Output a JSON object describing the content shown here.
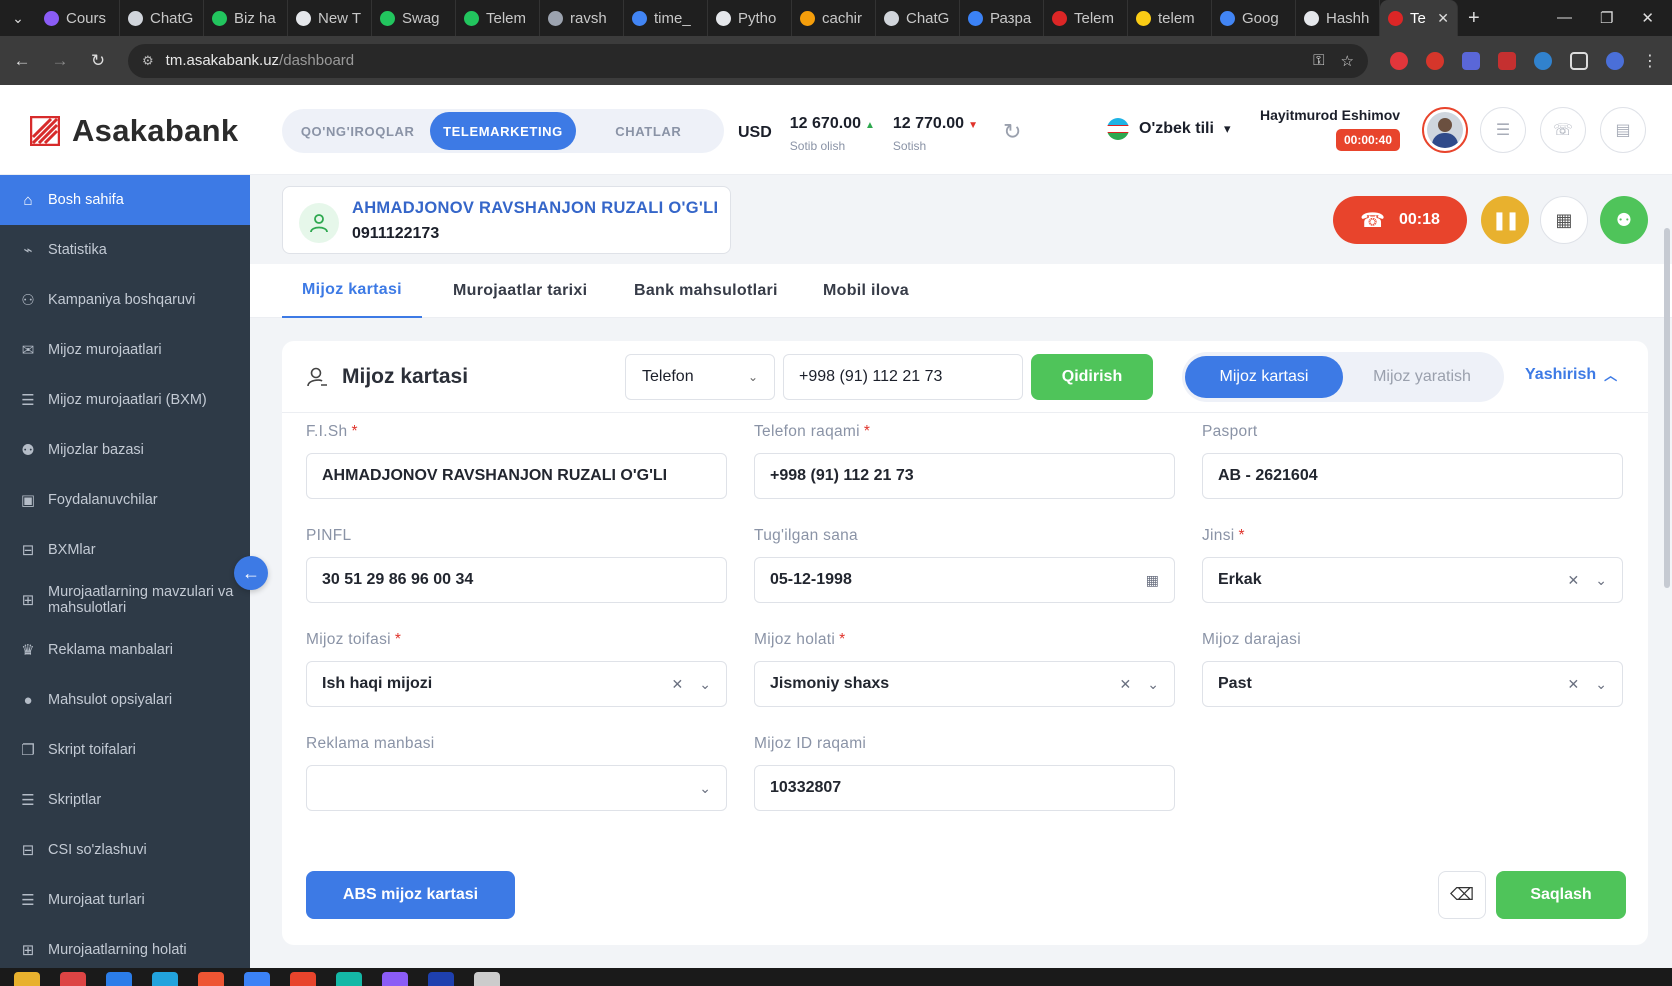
{
  "browser": {
    "tabs": [
      {
        "title": "Cours",
        "color": "#8b5cf6"
      },
      {
        "title": "ChatG",
        "color": "#d1d5db"
      },
      {
        "title": "Biz ha",
        "color": "#22c55e"
      },
      {
        "title": "New T",
        "color": "#e5e7eb"
      },
      {
        "title": "Swag",
        "color": "#22c55e"
      },
      {
        "title": "Telem",
        "color": "#22c55e"
      },
      {
        "title": "ravsh",
        "color": "#9ca3af"
      },
      {
        "title": "time_",
        "color": "#4285f4"
      },
      {
        "title": "Pytho",
        "color": "#e5e7eb"
      },
      {
        "title": "cachir",
        "color": "#f59e0b"
      },
      {
        "title": "ChatG",
        "color": "#d1d5db"
      },
      {
        "title": "Разра",
        "color": "#3b82f6"
      },
      {
        "title": "Telem",
        "color": "#dc2626"
      },
      {
        "title": "telem",
        "color": "#facc15"
      },
      {
        "title": "Goog",
        "color": "#4285f4"
      },
      {
        "title": "Hashh",
        "color": "#e5e7eb"
      },
      {
        "title": "Te",
        "color": "#dc2626"
      }
    ],
    "url_host": "tm.asakabank.uz",
    "url_path": "/dashboard"
  },
  "header": {
    "brand": "Asakabank",
    "modes": [
      "QO'NG'IROQLAR",
      "TELEMARKETING",
      "CHATLAR"
    ],
    "active_mode": "TELEMARKETING",
    "currency": {
      "code": "USD",
      "buy_value": "12 670.00",
      "buy_label": "Sotib olish",
      "sell_value": "12 770.00",
      "sell_label": "Sotish"
    },
    "language": "O'zbek tili",
    "user_name": "Hayitmurod Eshimov",
    "user_timer": "00:00:40"
  },
  "sidebar": {
    "items": [
      {
        "label": "Bosh sahifa",
        "icon": "home-icon",
        "glyph": "⌂"
      },
      {
        "label": "Statistika",
        "icon": "chart-icon",
        "glyph": "⌁"
      },
      {
        "label": "Kampaniya boshqaruvi",
        "icon": "users-group-icon",
        "glyph": "⚇"
      },
      {
        "label": "Mijoz murojaatlari",
        "icon": "chat-icon",
        "glyph": "✉"
      },
      {
        "label": "Mijoz murojaatlari (BXM)",
        "icon": "list-icon",
        "glyph": "☰"
      },
      {
        "label": "Mijozlar bazasi",
        "icon": "people-icon",
        "glyph": "⚉"
      },
      {
        "label": "Foydalanuvchilar",
        "icon": "user-card-icon",
        "glyph": "▣"
      },
      {
        "label": "BXMlar",
        "icon": "inbox-icon",
        "glyph": "⊟"
      },
      {
        "label": "Murojaatlarning mavzulari va mahsulotlari",
        "icon": "topics-icon",
        "glyph": "⊞"
      },
      {
        "label": "Reklama manbalari",
        "icon": "trophy-icon",
        "glyph": "♛"
      },
      {
        "label": "Mahsulot opsiyalari",
        "icon": "option-icon",
        "glyph": "●"
      },
      {
        "label": "Skript toifalari",
        "icon": "copy-icon",
        "glyph": "❐"
      },
      {
        "label": "Skriptlar",
        "icon": "script-icon",
        "glyph": "☰"
      },
      {
        "label": "CSI so'zlashuvi",
        "icon": "csi-icon",
        "glyph": "⊟"
      },
      {
        "label": "Murojaat turlari",
        "icon": "types-icon",
        "glyph": "☰"
      },
      {
        "label": "Murojaatlarning holati",
        "icon": "grid-icon",
        "glyph": "⊞"
      }
    ]
  },
  "caller": {
    "name": "AHMADJONOV RAVSHANJON RUZALI O'G'LI",
    "phone": "0911122173",
    "call_timer": "00:18"
  },
  "main_tabs": [
    "Mijoz kartasi",
    "Murojaatlar tarixi",
    "Bank mahsulotlari",
    "Mobil ilova"
  ],
  "card": {
    "title": "Mijoz kartasi",
    "search_type": "Telefon",
    "search_value": "+998 (91) 112 21 73",
    "search_button": "Qidirish",
    "segments": [
      "Mijoz kartasi",
      "Mijoz yaratish"
    ],
    "hide_label": "Yashirish",
    "fields": {
      "fish": {
        "label": "F.I.Sh",
        "value": "AHMADJONOV RAVSHANJON RUZALI O'G'LI"
      },
      "phone": {
        "label": "Telefon raqami",
        "value": "+998 (91) 112 21 73"
      },
      "passport": {
        "label": "Pasport",
        "value": "AB - 2621604"
      },
      "pinfl": {
        "label": "PINFL",
        "value": "30 51 29 86 96 00 34"
      },
      "birth": {
        "label": "Tug'ilgan sana",
        "value": "05-12-1998"
      },
      "gender": {
        "label": "Jinsi",
        "value": "Erkak"
      },
      "category": {
        "label": "Mijoz toifasi",
        "value": "Ish haqi mijozi"
      },
      "status": {
        "label": "Mijoz holati",
        "value": "Jismoniy shaxs"
      },
      "level": {
        "label": "Mijoz darajasi",
        "value": "Past"
      },
      "ad_source": {
        "label": "Reklama manbasi",
        "value": ""
      },
      "client_id": {
        "label": "Mijoz ID raqami",
        "value": "10332807"
      }
    },
    "abs_button": "ABS mijoz kartasi",
    "save_button": "Saqlash"
  },
  "colors": {
    "accent": "#3d7ae5",
    "success": "#4fc45a",
    "danger": "#e8442c",
    "warning": "#e8b12e",
    "sidebar": "#2e3a47"
  }
}
